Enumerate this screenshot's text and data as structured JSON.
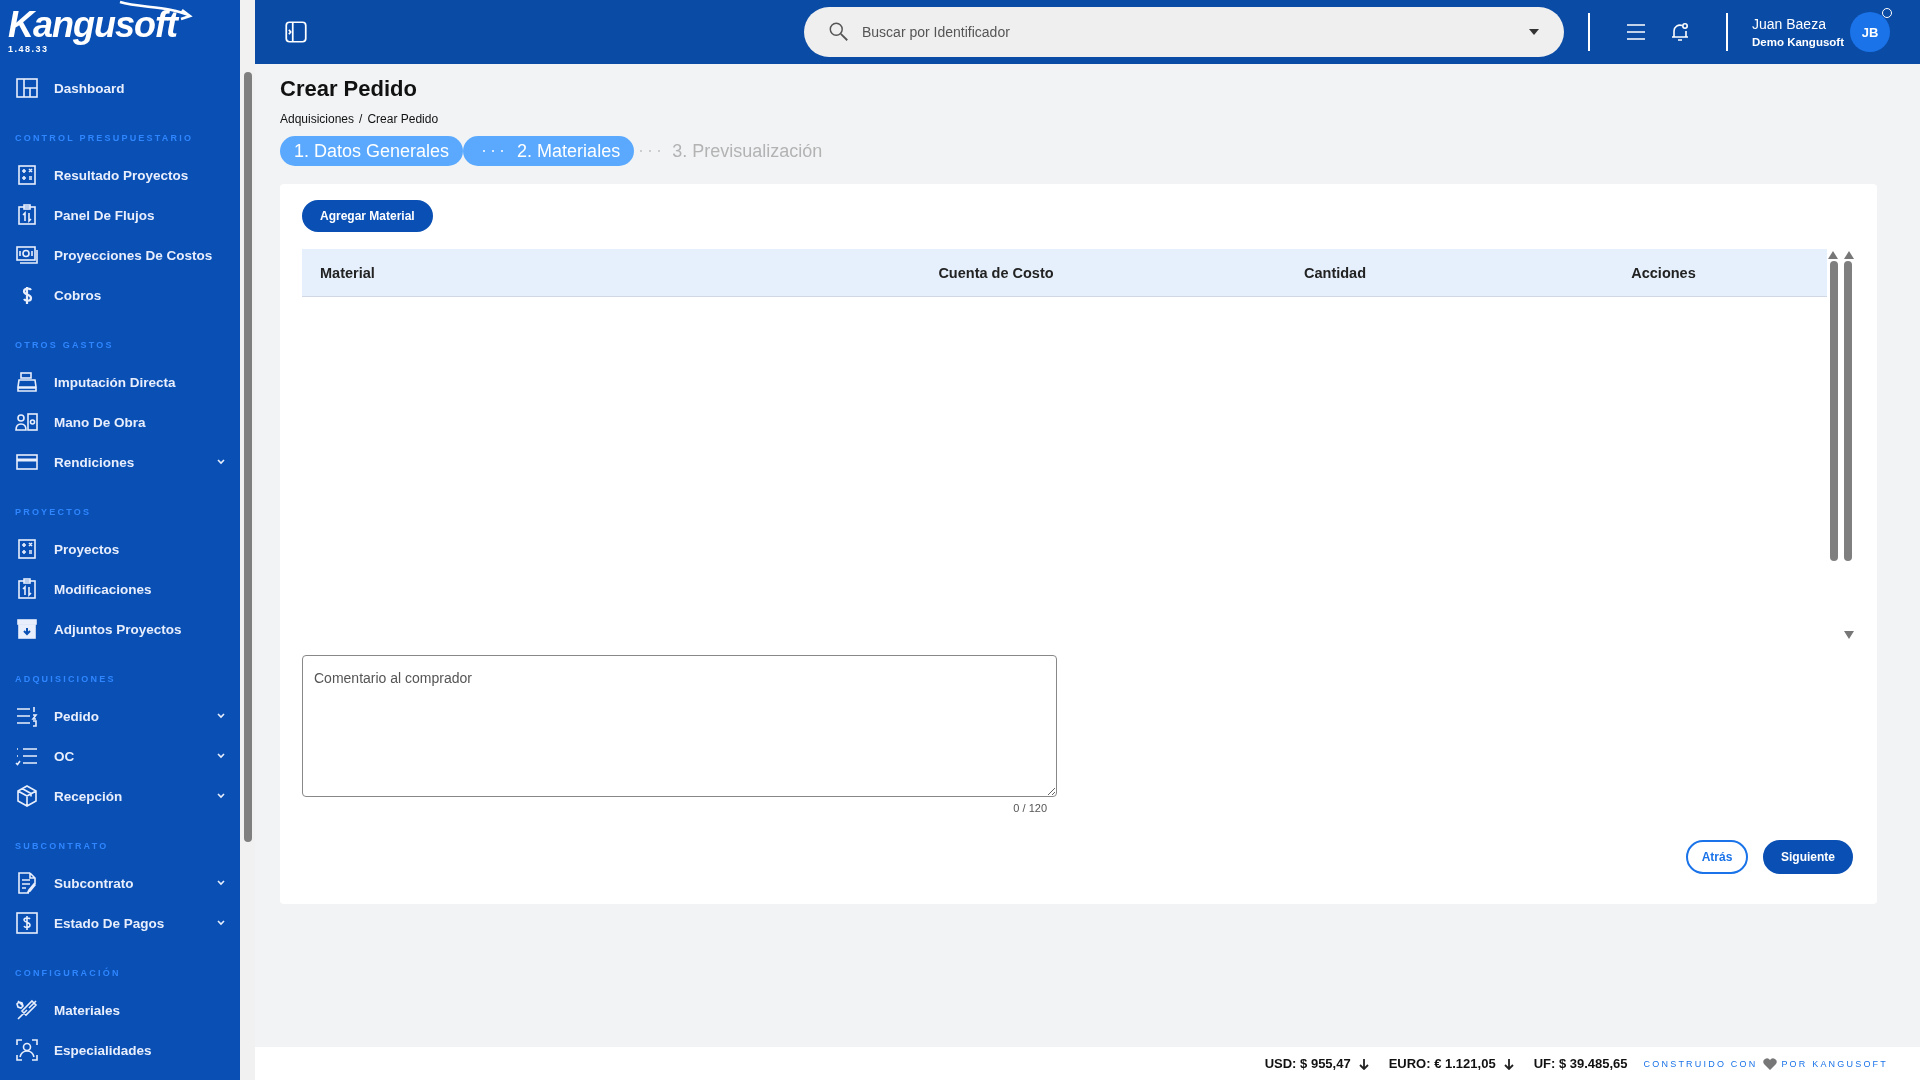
{
  "sidebar": {
    "logo": "Kangusoft",
    "version": "1.48.33",
    "sections": [
      {
        "items": [
          {
            "label": "Dashboard",
            "kind": "link"
          }
        ]
      },
      {
        "heading": "CONTROL PRESUPUESTARIO",
        "items": [
          {
            "label": "Resultado Proyectos",
            "kind": "link"
          },
          {
            "label": "Panel De Flujos",
            "kind": "link"
          },
          {
            "label": "Proyecciones De Costos",
            "kind": "link"
          },
          {
            "label": "Cobros",
            "kind": "link"
          }
        ]
      },
      {
        "heading": "OTROS GASTOS",
        "items": [
          {
            "label": "Imputación Directa",
            "kind": "link"
          },
          {
            "label": "Mano De Obra",
            "kind": "link"
          },
          {
            "label": "Rendiciones",
            "kind": "group"
          }
        ]
      },
      {
        "heading": "PROYECTOS",
        "items": [
          {
            "label": "Proyectos",
            "kind": "link"
          },
          {
            "label": "Modificaciones",
            "kind": "link"
          },
          {
            "label": "Adjuntos Proyectos",
            "kind": "link"
          }
        ]
      },
      {
        "heading": "ADQUISICIONES",
        "items": [
          {
            "label": "Pedido",
            "kind": "group"
          },
          {
            "label": "OC",
            "kind": "group"
          },
          {
            "label": "Recepción",
            "kind": "group"
          }
        ]
      },
      {
        "heading": "SUBCONTRATO",
        "items": [
          {
            "label": "Subcontrato",
            "kind": "group"
          },
          {
            "label": "Estado De Pagos",
            "kind": "group"
          }
        ]
      },
      {
        "heading": "CONFIGURACIÓN",
        "items": [
          {
            "label": "Materiales",
            "kind": "link"
          },
          {
            "label": "Especialidades",
            "kind": "link"
          }
        ]
      }
    ]
  },
  "header": {
    "search": {
      "placeholder": "Buscar por Identificador"
    },
    "user": {
      "name": "Juan Baeza",
      "company": "Demo Kangusoft",
      "initials": "JB",
      "online": false
    }
  },
  "page": {
    "title": "Crear Pedido",
    "breadcrumb": [
      "Adquisiciones",
      "Crear Pedido"
    ],
    "breadcrumb_separator": "/",
    "steps": [
      {
        "label": "1. Datos Generales",
        "reached": true
      },
      {
        "label": "2. Materiales",
        "reached": true
      },
      {
        "label": "3. Previsualización",
        "reached": false
      }
    ],
    "add_button": "Agregar Material",
    "table": {
      "columns": [
        "Material",
        "Cuenta de Costo",
        "Cantidad",
        "Acciones"
      ]
    },
    "comment": {
      "placeholder": "Comentario al comprador",
      "counter": "0 / 120"
    },
    "buttons": [
      {
        "label": "Atrás",
        "kind": "secondary"
      },
      {
        "label": "Siguiente",
        "kind": "primary"
      }
    ]
  },
  "footer": {
    "rates": [
      {
        "text": "USD: $ 955,47",
        "falling": true
      },
      {
        "text": "EURO: € 1.121,05",
        "falling": true
      },
      {
        "text": "UF: $ 39.485,65",
        "falling": false
      }
    ],
    "credit": [
      "CONSTRUIDO CON",
      "POR KANGUSOFT"
    ]
  }
}
